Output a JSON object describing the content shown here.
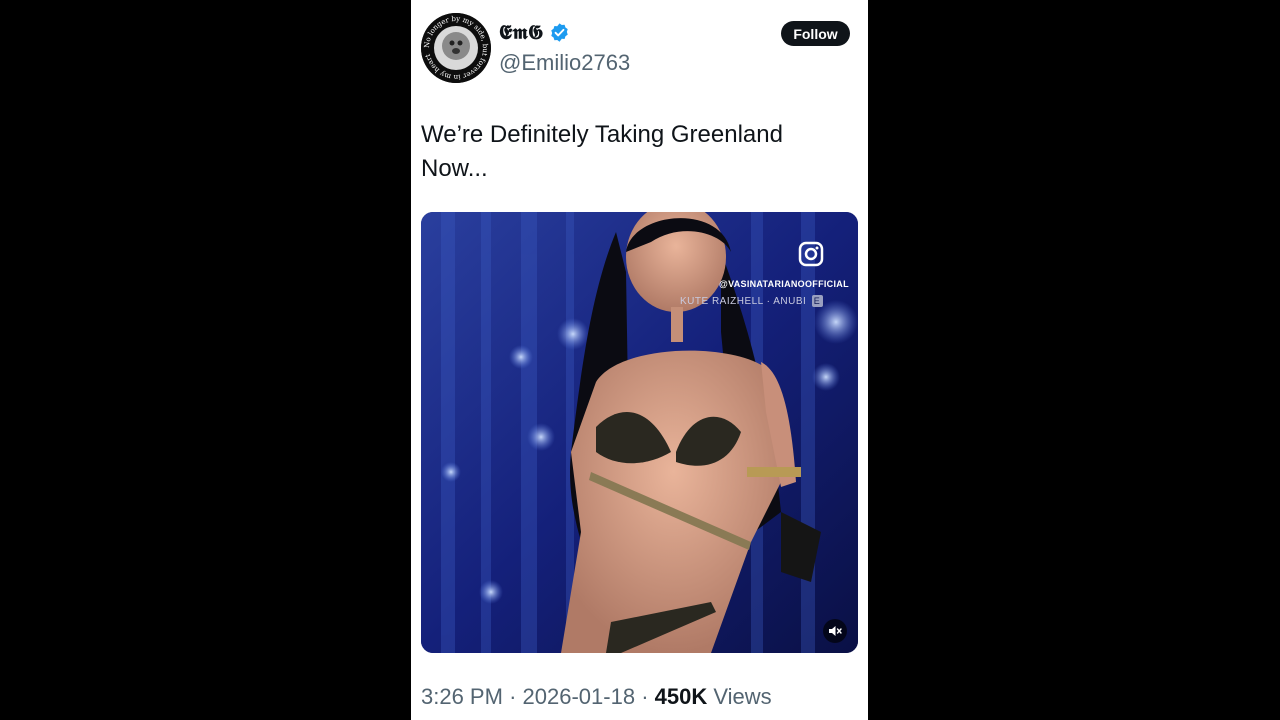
{
  "author": {
    "display_name": "𝕰𝖒𝕲",
    "handle": "@Emilio2763",
    "avatar_ring_text": "No longer by my side, but forever in my heart",
    "verified": true
  },
  "follow_label": "Follow",
  "tweet": {
    "text_line1": "We’re Definitely Taking Greenland",
    "text_line2": "Now..."
  },
  "media": {
    "watermark_handle": "@VASINATARIANOOFFICIAL",
    "watermark_credit": "KUTE RAIZHELL · ANUBI",
    "watermark_badge": "E",
    "icons": [
      "instagram-icon",
      "mute-icon"
    ]
  },
  "meta": {
    "time": "3:26 PM",
    "separator": "·",
    "date": "2026-01-18",
    "views_count": "450K",
    "views_label": "Views"
  },
  "colors": {
    "background": "#000000",
    "card": "#ffffff",
    "text_primary": "#0f1419",
    "text_secondary": "#536471",
    "verified_blue": "#1d9bf0"
  }
}
